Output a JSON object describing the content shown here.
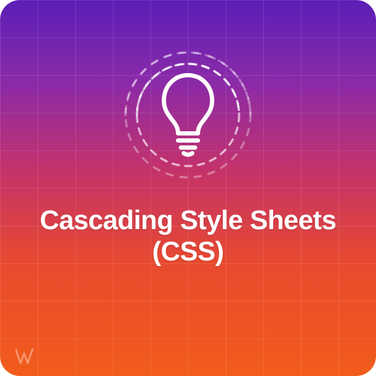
{
  "title_line1": "Cascading Style Sheets",
  "title_line2": "(CSS)",
  "icon_name": "lightbulb-icon",
  "logo_name": "brand-logo",
  "colors": {
    "gradient_top": "#5b1fb7",
    "gradient_bottom": "#f25c1b",
    "foreground": "#ffffff"
  }
}
